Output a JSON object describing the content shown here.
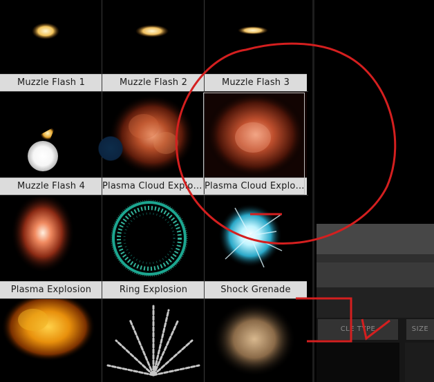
{
  "effects": [
    {
      "label": "Muzzle Flash 1"
    },
    {
      "label": "Muzzle Flash 2"
    },
    {
      "label": "Muzzle Flash 3"
    },
    {
      "label": "Muzzle Flash 4"
    },
    {
      "label": "Plasma Cloud Explos..."
    },
    {
      "label": "Plasma Cloud Explos..."
    },
    {
      "label": "Plasma Explosion"
    },
    {
      "label": "Ring Explosion"
    },
    {
      "label": "Shock Grenade"
    }
  ],
  "panel": {
    "col1_header": "CLE TYPE",
    "col2_header": "SIZE"
  },
  "colors": {
    "annotation": "#d41f1f",
    "label_bg": "#dcdcdc"
  }
}
